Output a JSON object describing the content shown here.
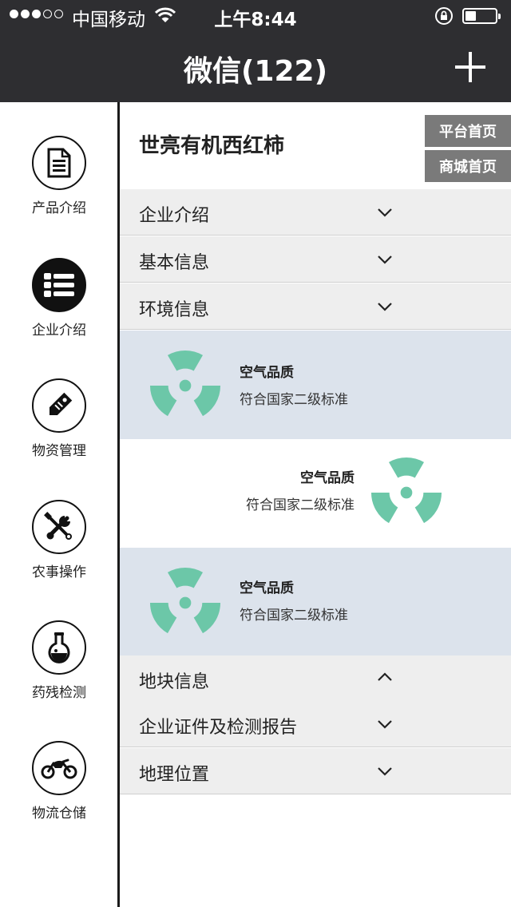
{
  "status_bar": {
    "carrier": "中国移动",
    "time": "上午8:44",
    "signal_bars": 3,
    "battery_level": 0.35
  },
  "nav": {
    "title": "微信(122)"
  },
  "sidebar": {
    "items": [
      {
        "label": "产品介绍",
        "icon": "document-icon",
        "active": false
      },
      {
        "label": "企业介绍",
        "icon": "list-icon",
        "active": true
      },
      {
        "label": "物资管理",
        "icon": "tag-icon",
        "active": false
      },
      {
        "label": "农事操作",
        "icon": "tools-icon",
        "active": false
      },
      {
        "label": "药残检测",
        "icon": "flask-icon",
        "active": false
      },
      {
        "label": "物流仓储",
        "icon": "motorcycle-icon",
        "active": false
      }
    ]
  },
  "header": {
    "company": "世亮有机西红柿",
    "platform_btn": "平台首页",
    "mall_btn": "商城首页"
  },
  "sections": [
    {
      "label": "企业介绍",
      "expanded": false
    },
    {
      "label": "基本信息",
      "expanded": false
    },
    {
      "label": "环境信息",
      "expanded": false
    }
  ],
  "env_cards": [
    {
      "title": "空气品质",
      "desc": "符合国家二级标准"
    },
    {
      "title": "空气品质",
      "desc": "符合国家二级标准"
    },
    {
      "title": "空气品质",
      "desc": "符合国家二级标准"
    }
  ],
  "sections_after": [
    {
      "label": "地块信息",
      "expanded": true
    },
    {
      "label": "企业证件及检测报告",
      "expanded": false
    },
    {
      "label": "地理位置",
      "expanded": false
    }
  ],
  "colors": {
    "accent": "#6cc7a8",
    "card_alt": "#dce3ec",
    "bar": "#2e2e31",
    "row": "#eeeeee",
    "button": "#7a7a7a"
  }
}
